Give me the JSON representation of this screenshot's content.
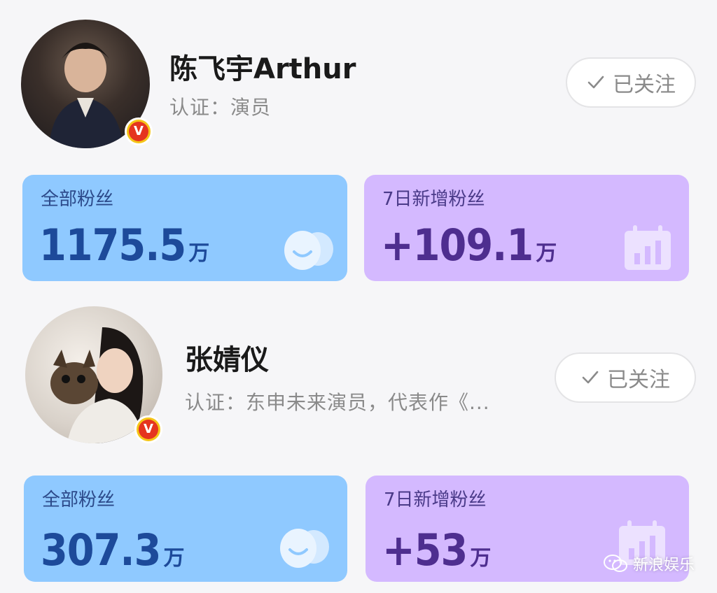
{
  "profiles": [
    {
      "name": "陈飞宇Arthur",
      "cert": "认证：演员",
      "follow_label": "已关注",
      "badge": "V",
      "stats": {
        "total_label": "全部粉丝",
        "total_value": "1175.5",
        "total_unit": "万",
        "new_label": "7日新增粉丝",
        "new_value": "+109.1",
        "new_unit": "万"
      }
    },
    {
      "name": "张婧仪",
      "cert": "认证：东申未来演员，代表作《...",
      "follow_label": "已关注",
      "badge": "V",
      "stats": {
        "total_label": "全部粉丝",
        "total_value": "307.3",
        "total_unit": "万",
        "new_label": "7日新增粉丝",
        "new_value": "+53",
        "new_unit": "万"
      }
    }
  ],
  "watermark": "新浪娱乐",
  "icons": {
    "check": "check-icon",
    "fans": "fans-icon",
    "calendar": "calendar-chart-icon",
    "verified": "verified-v-icon",
    "wechat": "wechat-icon"
  },
  "colors": {
    "blue_card": "#8fc9ff",
    "purple_card": "#d4b9ff",
    "badge_gold": "#f5c518",
    "badge_red": "#e5341f"
  }
}
